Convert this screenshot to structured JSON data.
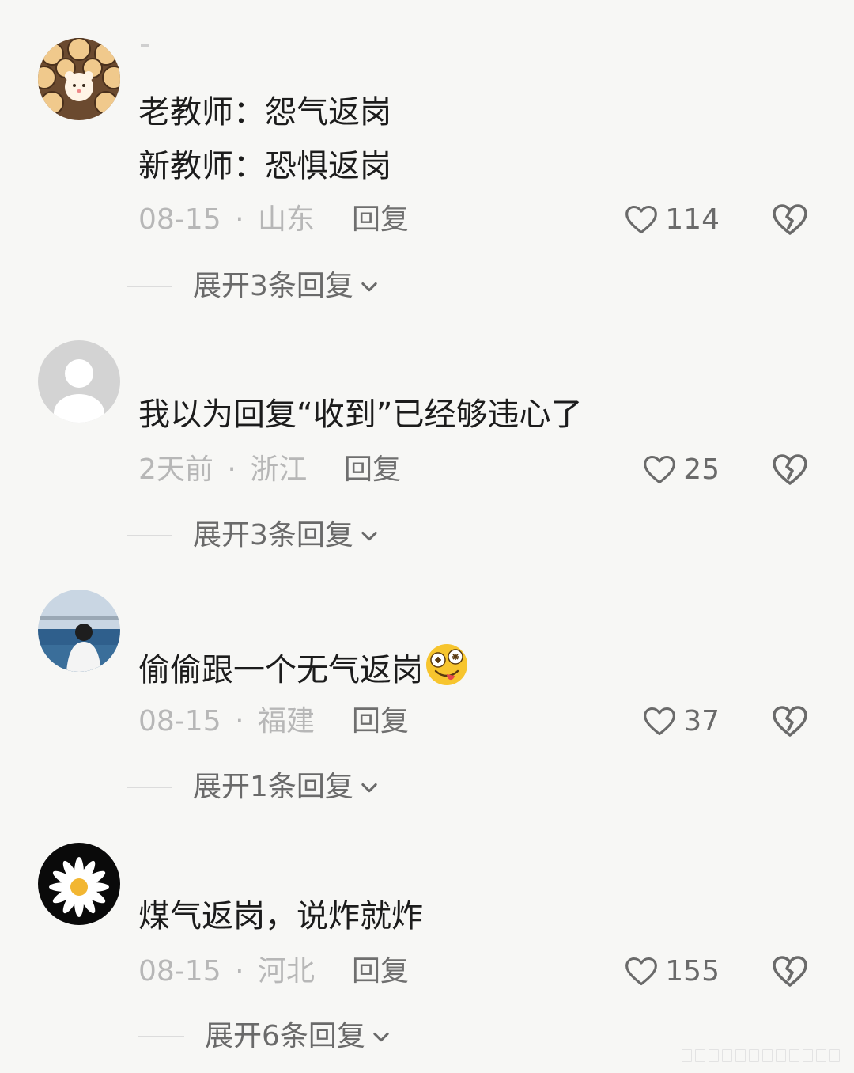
{
  "comments": [
    {
      "text_lines": [
        "老教师：怨气返岗",
        "新教师：恐惧返岗"
      ],
      "date": "08-15",
      "separator": "·",
      "location": "山东",
      "reply_label": "回复",
      "likes": "114",
      "expand_label": "展开3条回复"
    },
    {
      "text_lines": [
        "我以为回复“收到”已经够违心了"
      ],
      "date": "2天前",
      "separator": "·",
      "location": "浙江",
      "reply_label": "回复",
      "likes": "25",
      "expand_label": "展开3条回复"
    },
    {
      "text_lines": [
        "偷偷跟一个无气返岗"
      ],
      "emoji": "zany-face-emoji",
      "date": "08-15",
      "separator": "·",
      "location": "福建",
      "reply_label": "回复",
      "likes": "37",
      "expand_label": "展开1条回复"
    },
    {
      "text_lines": [
        "煤气返岗，说炸就炸"
      ],
      "date": "08-15",
      "separator": "·",
      "location": "河北",
      "reply_label": "回复",
      "likes": "155",
      "expand_label": "展开6条回复"
    }
  ],
  "colors": {
    "background": "#f7f7f5",
    "text": "#1c1c1c",
    "meta": "#b7b7b7",
    "action": "#6a6a6a"
  },
  "icons": {
    "like": "heart-outline-icon",
    "dislike": "broken-heart-icon",
    "expand": "chevron-down-icon"
  }
}
